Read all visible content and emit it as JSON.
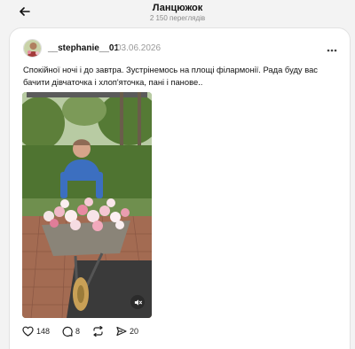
{
  "header": {
    "title": "Ланцюжок",
    "views": "2 150 переглядів"
  },
  "post": {
    "username": "__stephanie__01",
    "date": "03.06.2026",
    "text": "Спокійної ночі і до завтра. Зустрінемось на площі філармонії. Рада буду вас бачити дівчаточка і хлоп'яточка, пані і панове..",
    "media_type": "video",
    "likes": "148",
    "comments": "8",
    "shares": "20"
  },
  "icons": {
    "back": "arrow-left-icon",
    "more": "more-horizontal-icon",
    "like": "heart-icon",
    "comment": "comment-icon",
    "repost": "repost-icon",
    "share": "send-icon",
    "mute": "speaker-muted-icon"
  }
}
